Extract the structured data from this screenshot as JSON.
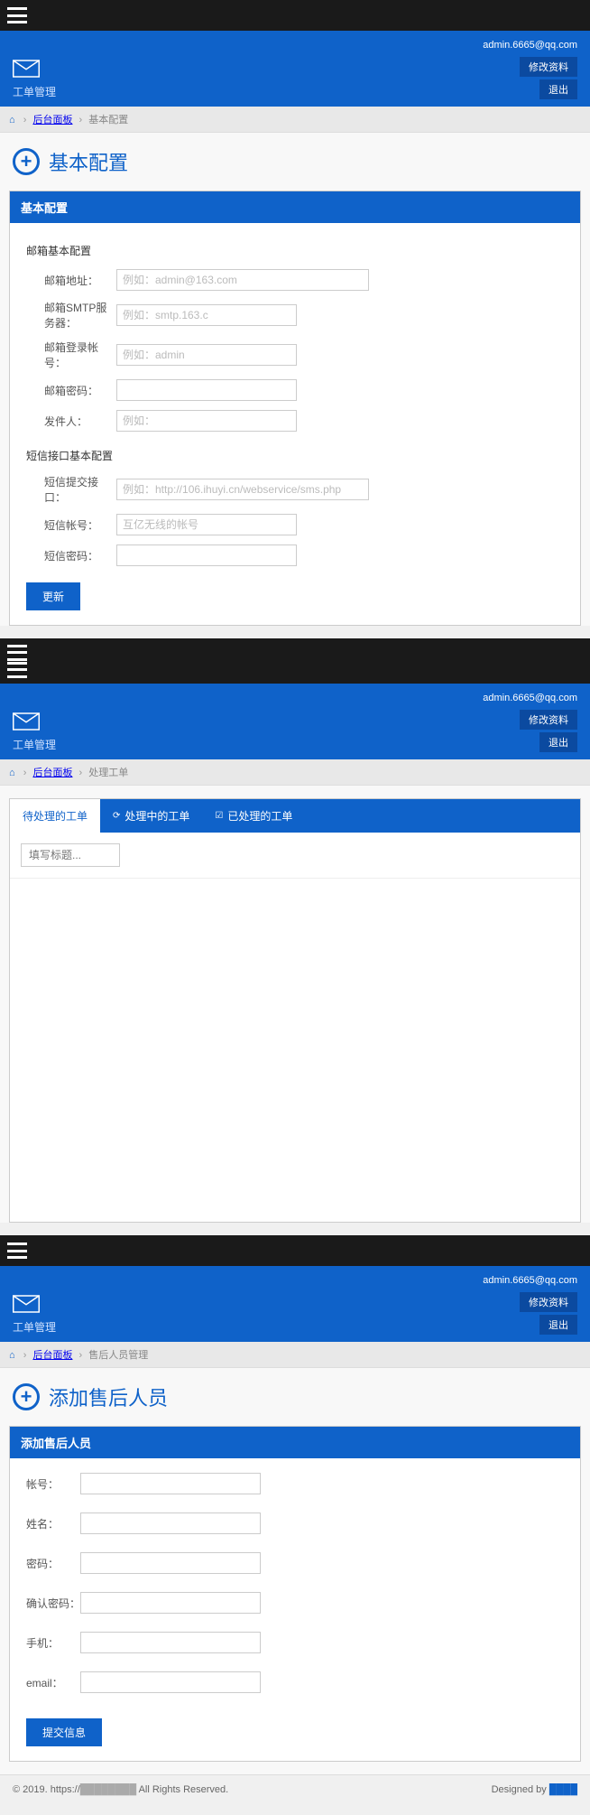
{
  "common": {
    "brand_text": "工单管理",
    "user_email": "admin.6665@qq.com",
    "edit_profile": "修改资料",
    "logout": "退出",
    "breadcrumb_home": "后台面板"
  },
  "screen1": {
    "breadcrumb_current": "基本配置",
    "page_title": "基本配置",
    "panel_title": "基本配置",
    "section_email": "邮箱基本配置",
    "fields_email": {
      "addr_label": "邮箱地址：",
      "addr_placeholder": "例如：admin@163.com",
      "smtp_label": "邮箱SMTP服务器：",
      "smtp_placeholder": "例如：smtp.163.c",
      "login_label": "邮箱登录帐号：",
      "login_placeholder": "例如：admin",
      "pwd_label": "邮箱密码：",
      "sender_label": "发件人：",
      "sender_placeholder": "例如："
    },
    "section_sms": "短信接口基本配置",
    "fields_sms": {
      "api_label": "短信提交接口：",
      "api_placeholder": "例如：http://106.ihuyi.cn/webservice/sms.php",
      "acct_label": "短信帐号：",
      "acct_placeholder": "互亿无线的帐号",
      "pwd_label": "短信密码："
    },
    "submit": "更新"
  },
  "screen2": {
    "breadcrumb_current": "处理工单",
    "tabs": {
      "pending": "待处理的工单",
      "processing": "处理中的工单",
      "done": "已处理的工单"
    },
    "search_placeholder": "填写标题..."
  },
  "screen3": {
    "breadcrumb_current": "售后人员管理",
    "page_title": "添加售后人员",
    "panel_title": "添加售后人员",
    "fields": {
      "account": "帐号：",
      "name": "姓名：",
      "password": "密码：",
      "confirm": "确认密码：",
      "phone": "手机：",
      "email": "email："
    },
    "submit": "提交信息"
  },
  "footer": {
    "copyright_prefix": "© 2019. https://",
    "copyright_suffix": " All Rights Reserved.",
    "designed_by": "Designed by "
  }
}
